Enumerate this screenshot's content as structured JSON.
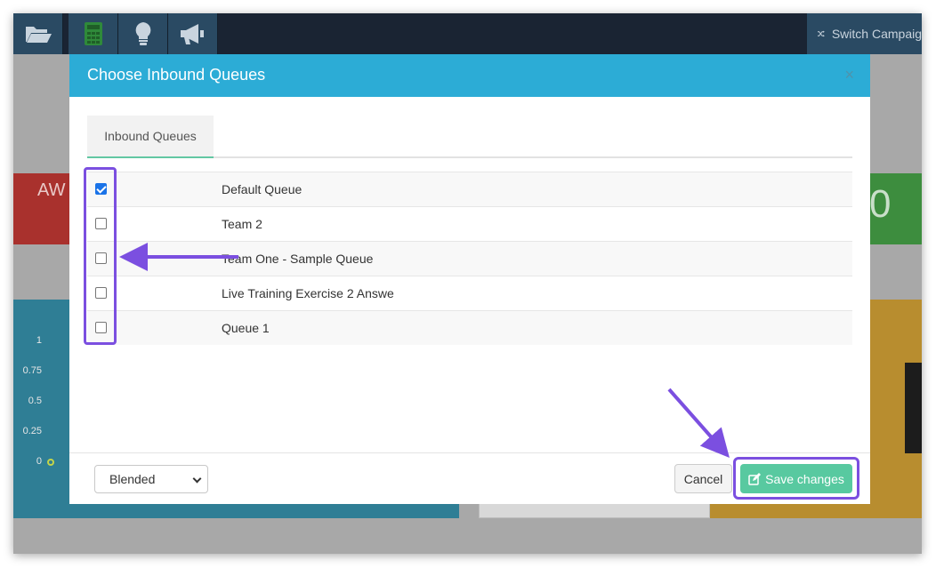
{
  "nav": {
    "buttons": [
      {
        "icon": "folder-open-icon"
      },
      {
        "icon": "calculator-icon"
      },
      {
        "icon": "lightbulb-icon"
      },
      {
        "icon": "megaphone-icon"
      }
    ],
    "switch_campaign_label": "Switch Campaig"
  },
  "background": {
    "red_card_label": "AW",
    "green_card_value": "0",
    "y_ticks": [
      "1",
      "0.75",
      "0.5",
      "0.25",
      "0"
    ]
  },
  "modal": {
    "title": "Choose Inbound Queues",
    "close_label": "×",
    "tab_label": "Inbound Queues",
    "queues": [
      {
        "name": "Default Queue",
        "checked": true
      },
      {
        "name": "Team 2",
        "checked": false
      },
      {
        "name": "Team One - Sample Queue",
        "checked": false
      },
      {
        "name": "Live Training Exercise 2 Answe",
        "checked": false
      },
      {
        "name": "Queue 1",
        "checked": false
      }
    ],
    "mode_select_value": "Blended",
    "cancel_label": "Cancel",
    "save_label": "Save changes"
  },
  "colors": {
    "header": "#2cacd6",
    "save_button": "#58c9a0",
    "annotation": "#7b4fe0",
    "checkbox_checked": "#1a73e8"
  }
}
